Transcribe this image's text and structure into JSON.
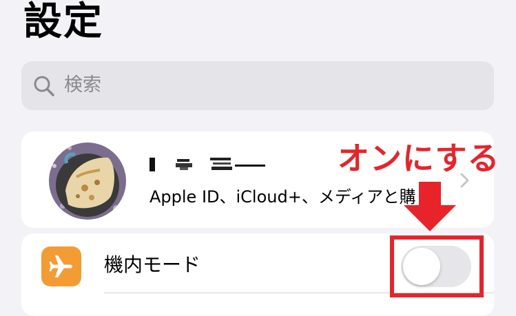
{
  "page_title": "設定",
  "search": {
    "placeholder": "検索"
  },
  "profile": {
    "subtitle": "Apple ID、iCloud+、メディアと購"
  },
  "settings": {
    "airplane_mode": {
      "label": "機内モード",
      "toggle_on": false
    }
  },
  "annotation": {
    "text": "オンにする",
    "color": "#e8232a"
  },
  "colors": {
    "background": "#f2f2f7",
    "airplane_icon_bg": "#f39c34",
    "toggle_off_track": "#e6e6ea"
  }
}
